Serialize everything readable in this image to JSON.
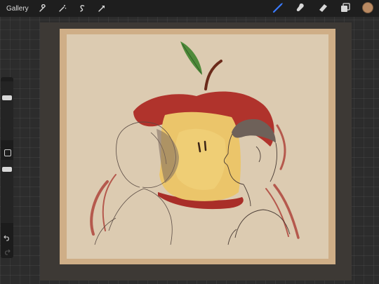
{
  "topbar": {
    "gallery_label": "Gallery",
    "left_tools": [
      "wrench-icon",
      "magic-wand-icon",
      "selection-icon",
      "transform-arrow-icon"
    ],
    "right_tools": [
      "brush-icon",
      "smudge-icon",
      "eraser-icon",
      "layers-icon"
    ],
    "active_tool": "brush-icon",
    "brush_accent": "#3a7bff",
    "current_color": "#b98a63"
  },
  "sidebar": {
    "brush_size_level": 0.2,
    "opacity_level": 0.8,
    "icons": [
      "modify-button",
      "undo-icon",
      "redo-icon"
    ]
  }
}
